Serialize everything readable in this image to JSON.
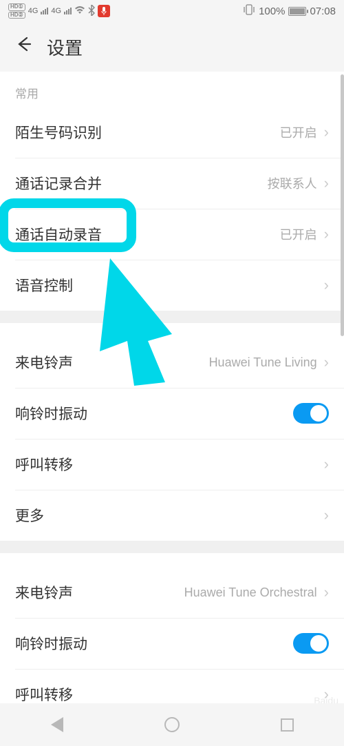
{
  "status": {
    "battery_pct": "100%",
    "time": "07:08",
    "signal_label": "4G"
  },
  "header": {
    "title": "设置"
  },
  "sections": [
    {
      "header": "常用",
      "rows": [
        {
          "label": "陌生号码识别",
          "value": "已开启",
          "type": "arrow"
        },
        {
          "label": "通话记录合并",
          "value": "按联系人",
          "type": "arrow"
        },
        {
          "label": "通话自动录音",
          "value": "已开启",
          "type": "arrow",
          "highlighted": true
        },
        {
          "label": "语音控制",
          "value": "",
          "type": "arrow"
        }
      ]
    },
    {
      "header": "",
      "rows": [
        {
          "label": "来电铃声",
          "value": "Huawei Tune Living",
          "type": "arrow"
        },
        {
          "label": "响铃时振动",
          "value": "",
          "type": "switch",
          "on": true
        },
        {
          "label": "呼叫转移",
          "value": "",
          "type": "arrow"
        },
        {
          "label": "更多",
          "value": "",
          "type": "arrow"
        }
      ]
    },
    {
      "header": "",
      "rows": [
        {
          "label": "来电铃声",
          "value": "Huawei Tune Orchestral",
          "type": "arrow"
        },
        {
          "label": "响铃时振动",
          "value": "",
          "type": "switch",
          "on": true
        },
        {
          "label": "呼叫转移",
          "value": "",
          "type": "arrow"
        }
      ]
    }
  ],
  "annotation": {
    "highlight_color": "#00d7e9",
    "arrow_color": "#00d7e9"
  }
}
